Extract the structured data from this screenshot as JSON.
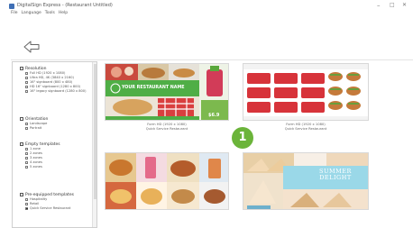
{
  "app": {
    "title": "DigitalSign Express - (Restaurant Untitled)"
  },
  "menu": [
    "File",
    "Language",
    "Tools",
    "Help"
  ],
  "window_controls": {
    "minimize": "–",
    "maximize": "□",
    "close": "✕"
  },
  "sidebar": {
    "sections": [
      {
        "label": "Resolution",
        "options": [
          {
            "label": "Full HD (1920 x 1080)",
            "checked": false
          },
          {
            "label": "Ultra HD, 4K (3840 x 2160)",
            "checked": false
          },
          {
            "label": "16\" signboard (800 x 480)",
            "checked": false
          },
          {
            "label": "HD 16\" signboard (1280 x 800)",
            "checked": false
          },
          {
            "label": "16\" legacy signboard (1280 x 800)",
            "checked": false
          }
        ]
      },
      {
        "label": "Orientation",
        "options": [
          {
            "label": "Landscape",
            "checked": false
          },
          {
            "label": "Portrait",
            "checked": false
          }
        ]
      },
      {
        "label": "Empty templates",
        "options": [
          {
            "label": "1 zone",
            "checked": false
          },
          {
            "label": "2 zones",
            "checked": false
          },
          {
            "label": "3 zones",
            "checked": false
          },
          {
            "label": "4 zones",
            "checked": false
          },
          {
            "label": "5 zones",
            "checked": false
          }
        ]
      },
      {
        "label": "Pre-equipped templates",
        "options": [
          {
            "label": "Hospitality",
            "checked": false
          },
          {
            "label": "Retail",
            "checked": false
          },
          {
            "label": "Quick Service Restaurant",
            "checked": true
          }
        ]
      }
    ]
  },
  "templates": [
    {
      "name": "Form HD (1920 x 1080)\nQuick Service Restaurant",
      "banner": "YOUR RESTAURANT NAME",
      "price": "$6.9"
    },
    {
      "name": "Form HD (1920 x 1080)\nQuick Service Restaurant"
    },
    {
      "name": ""
    },
    {
      "name": "",
      "banner": "SUMMER\nDELIGHT"
    }
  ],
  "badge": {
    "label": "1",
    "color": "#6bb43a"
  },
  "colors": {
    "accent_green": "#4fae46",
    "menu_red": "#d7333a",
    "summer_blue": "#9ad8e8"
  }
}
